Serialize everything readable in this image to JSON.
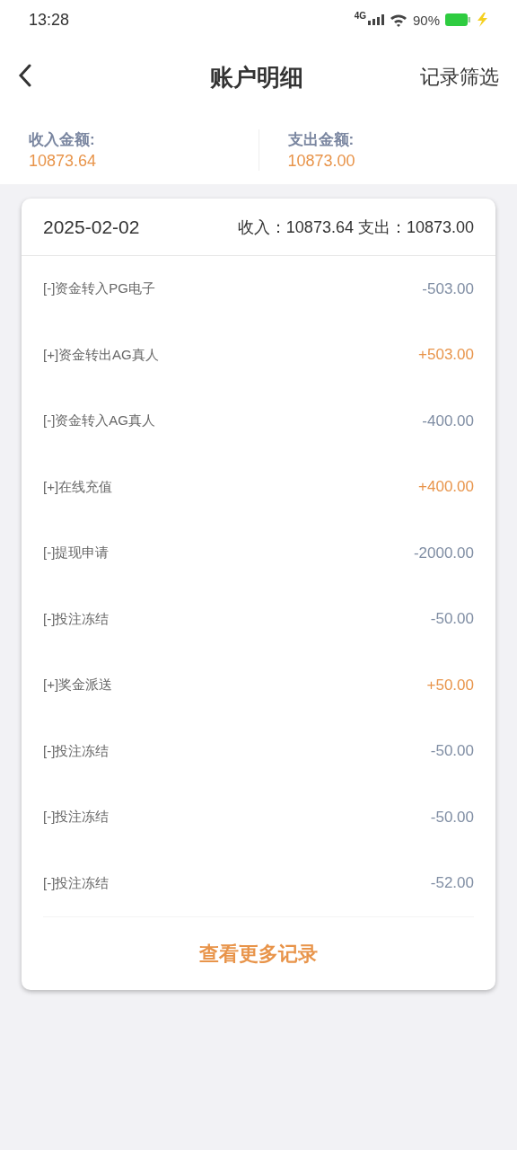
{
  "status_bar": {
    "time": "13:28",
    "network": "4G",
    "battery": "90%"
  },
  "nav": {
    "title": "账户明细",
    "action": "记录筛选"
  },
  "summary": [
    {
      "label": "收入金额:",
      "value": "10873.64"
    },
    {
      "label": "支出金额:",
      "value": "10873.00"
    }
  ],
  "day": {
    "date": "2025-02-02",
    "totals": "收入：10873.64 支出：10873.00",
    "records": [
      {
        "title": "[-]资金转入PG电子",
        "amount": "-503.00",
        "kind": "expense"
      },
      {
        "title": "[+]资金转出AG真人",
        "amount": "+503.00",
        "kind": "income"
      },
      {
        "title": "[-]资金转入AG真人",
        "amount": "-400.00",
        "kind": "expense"
      },
      {
        "title": "[+]在线充值",
        "amount": "+400.00",
        "kind": "income"
      },
      {
        "title": "[-]提现申请",
        "amount": "-2000.00",
        "kind": "expense"
      },
      {
        "title": "[-]投注冻结",
        "amount": "-50.00",
        "kind": "expense"
      },
      {
        "title": "[+]奖金派送",
        "amount": "+50.00",
        "kind": "income"
      },
      {
        "title": "[-]投注冻结",
        "amount": "-50.00",
        "kind": "expense"
      },
      {
        "title": "[-]投注冻结",
        "amount": "-50.00",
        "kind": "expense"
      },
      {
        "title": "[-]投注冻结",
        "amount": "-52.00",
        "kind": "expense"
      }
    ],
    "more": "查看更多记录"
  }
}
